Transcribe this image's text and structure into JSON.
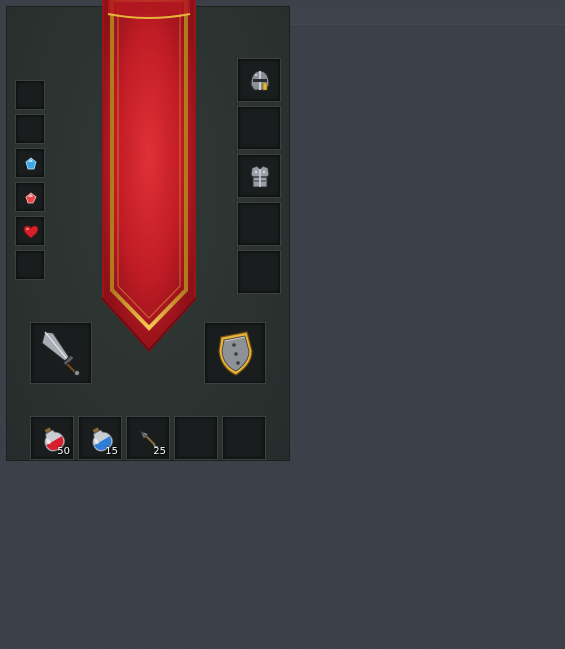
{
  "inventory": {
    "trinket_slots": [
      {
        "item": "",
        "icon": "empty-slot"
      },
      {
        "item": "",
        "icon": "empty-slot"
      },
      {
        "item": "blue-gem",
        "icon": "blue-gem-icon"
      },
      {
        "item": "red-gem",
        "icon": "red-gem-icon"
      },
      {
        "item": "heart",
        "icon": "heart-icon"
      },
      {
        "item": "",
        "icon": "empty-slot"
      }
    ],
    "armor_slots": [
      {
        "item": "helmet",
        "icon": "helmet-icon"
      },
      {
        "item": "",
        "icon": "empty-slot"
      },
      {
        "item": "chest-armor",
        "icon": "chest-armor-icon"
      },
      {
        "item": "",
        "icon": "empty-slot"
      },
      {
        "item": "",
        "icon": "empty-slot"
      }
    ],
    "weapon_slot": {
      "item": "sword",
      "icon": "sword-icon"
    },
    "offhand_slot": {
      "item": "shield",
      "icon": "shield-icon"
    },
    "quick_slots": [
      {
        "item": "red-potion",
        "icon": "red-potion-icon",
        "count": "50"
      },
      {
        "item": "blue-potion",
        "icon": "blue-potion-icon",
        "count": "15"
      },
      {
        "item": "arrow",
        "icon": "arrow-icon",
        "count": "25"
      },
      {
        "item": "",
        "icon": "empty-slot",
        "count": ""
      },
      {
        "item": "",
        "icon": "empty-slot",
        "count": ""
      }
    ]
  },
  "colors": {
    "banner_red": "#c8202a",
    "banner_gold": "#e8b33a",
    "slot_bg": "#1a1d1d",
    "panel_bg": "#2b3230"
  }
}
